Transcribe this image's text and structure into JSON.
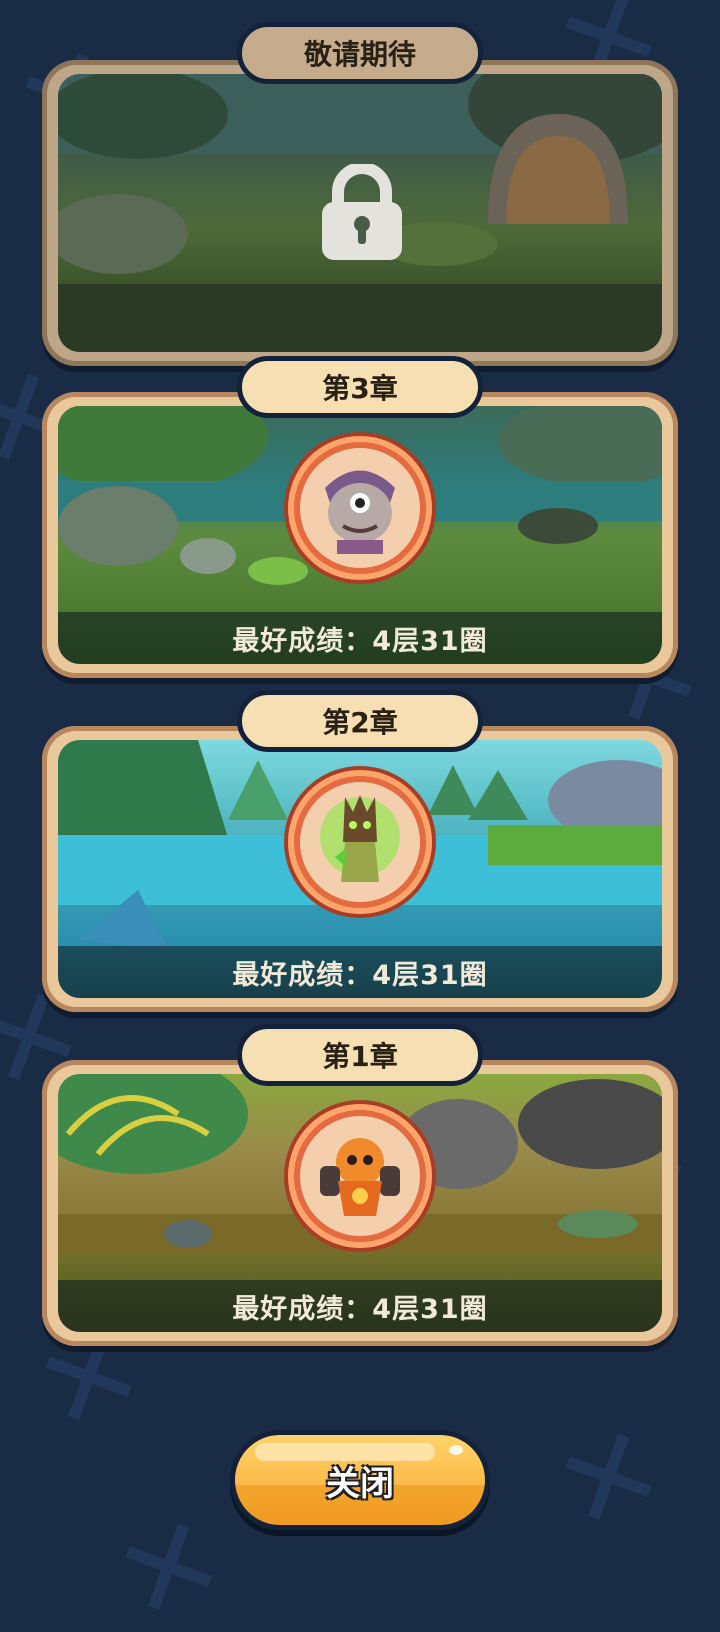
{
  "locked_chapter": {
    "title": "敬请期待",
    "icon": "lock-icon"
  },
  "chapters": [
    {
      "title": "第3章",
      "score": "最好成绩：4层31圈",
      "boss_icon": "cyclops-boss-icon"
    },
    {
      "title": "第2章",
      "score": "最好成绩：4层31圈",
      "boss_icon": "tree-ent-boss-icon"
    },
    {
      "title": "第1章",
      "score": "最好成绩：4层31圈",
      "boss_icon": "lava-golem-boss-icon"
    }
  ],
  "close_button": {
    "label": "关闭"
  },
  "colors": {
    "background": "#1a2b45",
    "card_border": "#e9c89b",
    "medal": "#e46a3f",
    "button": "#fcbb4a"
  }
}
